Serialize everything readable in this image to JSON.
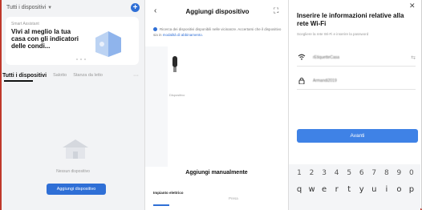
{
  "colors": {
    "accent": "#2f6fd6",
    "frame": "#c0392b",
    "button": "#3f82e6"
  },
  "panel1": {
    "home_selector": "Tutti i dispositivi",
    "plus_icon": "plus-icon",
    "card": {
      "small_text": "Smart Assistant",
      "title": "Vivi al meglio la tua casa con gli indicatori delle condi..."
    },
    "tabs": [
      "Tutti i dispositivi",
      "Salotto",
      "Stanza da letto"
    ],
    "tabs_more": "···",
    "empty_text": "Nessun dispositivo",
    "add_button": "Aggiungi dispositivo"
  },
  "panel2": {
    "back_icon": "back-arrow-icon",
    "title": "Aggiungi dispositivo",
    "scan_icon": "scan-icon",
    "info_text": "Ricerca dei dispositivi disponibili nelle vicinanze. Accertarsi che il dispositivo sia in",
    "info_link": "modalità di abbinamento.",
    "device_label": "Dispositivo",
    "manual_label": "Aggiungi manualmente",
    "bottom_left": "Impianto elettrico",
    "bottom_right": "Presa"
  },
  "panel3": {
    "close_icon": "close-icon",
    "title": "Inserire le informazioni relative alla rete Wi-Fi",
    "subtitle": "Scegliere la rete Wi-Fi e inserire la password",
    "wifi_name": "rEtiquetteCasa",
    "password": "Armandi2019",
    "next_button": "Avanti",
    "keyboard": {
      "digits": [
        "1",
        "2",
        "3",
        "4",
        "5",
        "6",
        "7",
        "8",
        "9",
        "0"
      ],
      "letters": [
        "q",
        "w",
        "e",
        "r",
        "t",
        "y",
        "u",
        "i",
        "o",
        "p"
      ]
    }
  }
}
